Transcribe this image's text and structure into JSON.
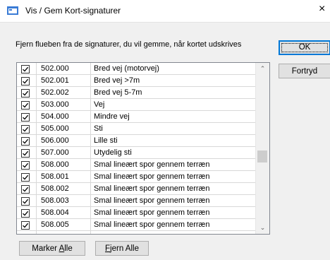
{
  "window": {
    "title": "Vis / Gem Kort-signaturer",
    "close_glyph": "×"
  },
  "instructions": "Fjern flueben fra de signaturer, du vil gemme, når kortet udskrives",
  "buttons": {
    "ok": "OK",
    "fortryd": "Fortryd",
    "marker_alle_prefix": "Marker ",
    "marker_alle_underlined": "A",
    "marker_alle_suffix": "lle",
    "fjern_alle_underlined": "F",
    "fjern_alle_suffix": "jern Alle"
  },
  "list": {
    "rows": [
      {
        "code": "502.000",
        "name": "Bred vej (motorvej)",
        "checked": true
      },
      {
        "code": "502.001",
        "name": "Bred vej >7m",
        "checked": true
      },
      {
        "code": "502.002",
        "name": "Bred vej 5-7m",
        "checked": true
      },
      {
        "code": "503.000",
        "name": "Vej",
        "checked": true
      },
      {
        "code": "504.000",
        "name": "Mindre vej",
        "checked": true
      },
      {
        "code": "505.000",
        "name": "Sti",
        "checked": true
      },
      {
        "code": "506.000",
        "name": "Lille sti",
        "checked": true
      },
      {
        "code": "507.000",
        "name": "Utydelig sti",
        "checked": true
      },
      {
        "code": "508.000",
        "name": "Smal lineært spor gennem terræn",
        "checked": true
      },
      {
        "code": "508.001",
        "name": "Smal lineært spor gennem terræn",
        "checked": true
      },
      {
        "code": "508.002",
        "name": "Smal lineært spor gennem terræn",
        "checked": true
      },
      {
        "code": "508.003",
        "name": "Smal lineært spor gennem terræn",
        "checked": true
      },
      {
        "code": "508.004",
        "name": "Smal lineært spor gennem terræn",
        "checked": true
      },
      {
        "code": "508.005",
        "name": "Smal lineært spor gennem terræn",
        "checked": true
      }
    ]
  },
  "icons": {
    "app": "map-window-icon",
    "scroll_up": "chevron-up-icon",
    "scroll_down": "chevron-down-icon",
    "check": "checkmark-icon"
  },
  "colors": {
    "accent": "#0078d7",
    "background": "#f0f0f0"
  }
}
